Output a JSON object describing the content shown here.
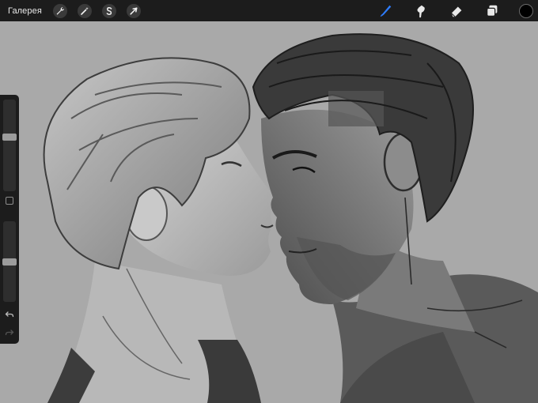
{
  "toolbar": {
    "gallery_label": "Галерея",
    "left_tools": [
      {
        "name": "wrench-icon",
        "label": "actions"
      },
      {
        "name": "magic-wand-icon",
        "label": "adjustments"
      },
      {
        "name": "selection-s-icon",
        "label": "selection"
      },
      {
        "name": "arrow-cursor-icon",
        "label": "transform"
      }
    ],
    "right_tools": [
      {
        "name": "brush-icon",
        "active": true
      },
      {
        "name": "smudge-icon",
        "active": false
      },
      {
        "name": "eraser-icon",
        "active": false
      },
      {
        "name": "layers-icon",
        "active": false
      }
    ],
    "accent_color": "#2e7dff",
    "current_color": "#000000"
  },
  "sidebar": {
    "brush_size_level": 0.6,
    "opacity_level": 0.5
  },
  "canvas": {
    "background_color": "#a9a9a9"
  }
}
